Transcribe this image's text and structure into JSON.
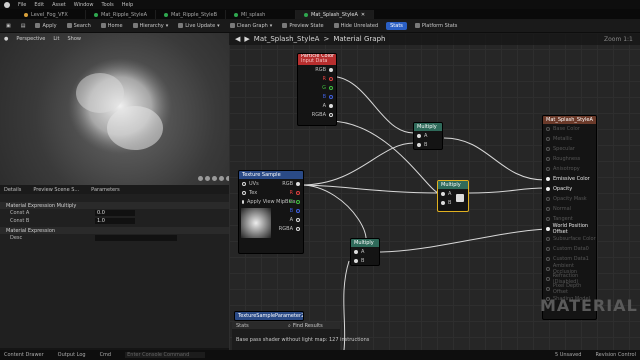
{
  "menu": [
    "File",
    "Edit",
    "Asset",
    "Window",
    "Tools",
    "Help"
  ],
  "tabs": [
    {
      "label": "Level_Fog_VFX",
      "color": "#d8a03a",
      "active": false
    },
    {
      "label": "Mat_Ripple_StyleA",
      "color": "#2fa84f",
      "active": false
    },
    {
      "label": "Mat_Ripple_StyleB",
      "color": "#2fa84f",
      "active": false
    },
    {
      "label": "MI_splash",
      "color": "#2fa84f",
      "active": false
    },
    {
      "label": "Mat_Splash_StyleA",
      "color": "#2fa84f",
      "active": true
    }
  ],
  "toolbar": [
    "Apply",
    "Search",
    "Home",
    "Hierarchy",
    "Live Update",
    "Clean Graph",
    "Preview State",
    "Hide Unrelated",
    "Stats",
    "Platform Stats"
  ],
  "viewport": {
    "tools": [
      "Perspective",
      "Lit",
      "Show"
    ]
  },
  "panel_tabs": [
    "Details",
    "Preview Scene S...",
    "Parameters"
  ],
  "details": {
    "cat1": "Material Expression Multiply",
    "rows": [
      {
        "label": "Const A",
        "value": "0.0"
      },
      {
        "label": "Const B",
        "value": "1.0"
      }
    ],
    "cat2": "Material Expression",
    "desc_label": "Desc"
  },
  "graph": {
    "crumb1": "Mat_Splash_StyleA",
    "sep": ">",
    "crumb2": "Material Graph",
    "zoom": "Zoom 1:1",
    "watermark": "MATERIAL"
  },
  "particle_color": {
    "title": "Particle Color",
    "subtitle": "Input Data",
    "pins": [
      "RGB",
      "R",
      "G",
      "B",
      "A",
      "RGBA"
    ]
  },
  "texture_sample": {
    "title": "Texture Sample",
    "inputs": [
      "UVs",
      "Tex",
      "Apply View MipBias"
    ],
    "outputs": [
      "RGB",
      "R",
      "G",
      "B",
      "A",
      "RGBA"
    ]
  },
  "multiply_nodes": [
    {
      "title": "Multiply"
    },
    {
      "title": "Multiply"
    },
    {
      "title": "Multiply"
    }
  ],
  "pins_ab": [
    "A",
    "B"
  ],
  "result": {
    "title": "Mat_Splash_StyleA",
    "pins": [
      {
        "label": "Base Color",
        "on": false
      },
      {
        "label": "Metallic",
        "on": false
      },
      {
        "label": "Specular",
        "on": false
      },
      {
        "label": "Roughness",
        "on": false
      },
      {
        "label": "Anisotropy",
        "on": false
      },
      {
        "label": "Emissive Color",
        "on": true
      },
      {
        "label": "Opacity",
        "on": true
      },
      {
        "label": "Opacity Mask",
        "on": false
      },
      {
        "label": "Normal",
        "on": false
      },
      {
        "label": "Tangent",
        "on": false
      },
      {
        "label": "World Position Offset",
        "on": true
      },
      {
        "label": "Subsurface Color",
        "on": false
      },
      {
        "label": "Custom Data0",
        "on": false
      },
      {
        "label": "Custom Data1",
        "on": false
      },
      {
        "label": "Ambient Occlusion",
        "on": false
      },
      {
        "label": "Refraction (Disabled)",
        "on": false
      },
      {
        "label": "Pixel Depth Offset",
        "on": false
      },
      {
        "label": "Shading Model",
        "on": false
      }
    ]
  },
  "lerp_node": {
    "title": "TextureSampleParameter2D"
  },
  "stats": {
    "tab": "Stats",
    "find_tab": "Find Results",
    "line": "Base pass shader without light map: 127 instructions"
  },
  "statusbar": [
    "Content Drawer",
    "Output Log",
    "Cmd",
    "Enter Console Command",
    "5 Unsaved",
    "Revision Control"
  ]
}
